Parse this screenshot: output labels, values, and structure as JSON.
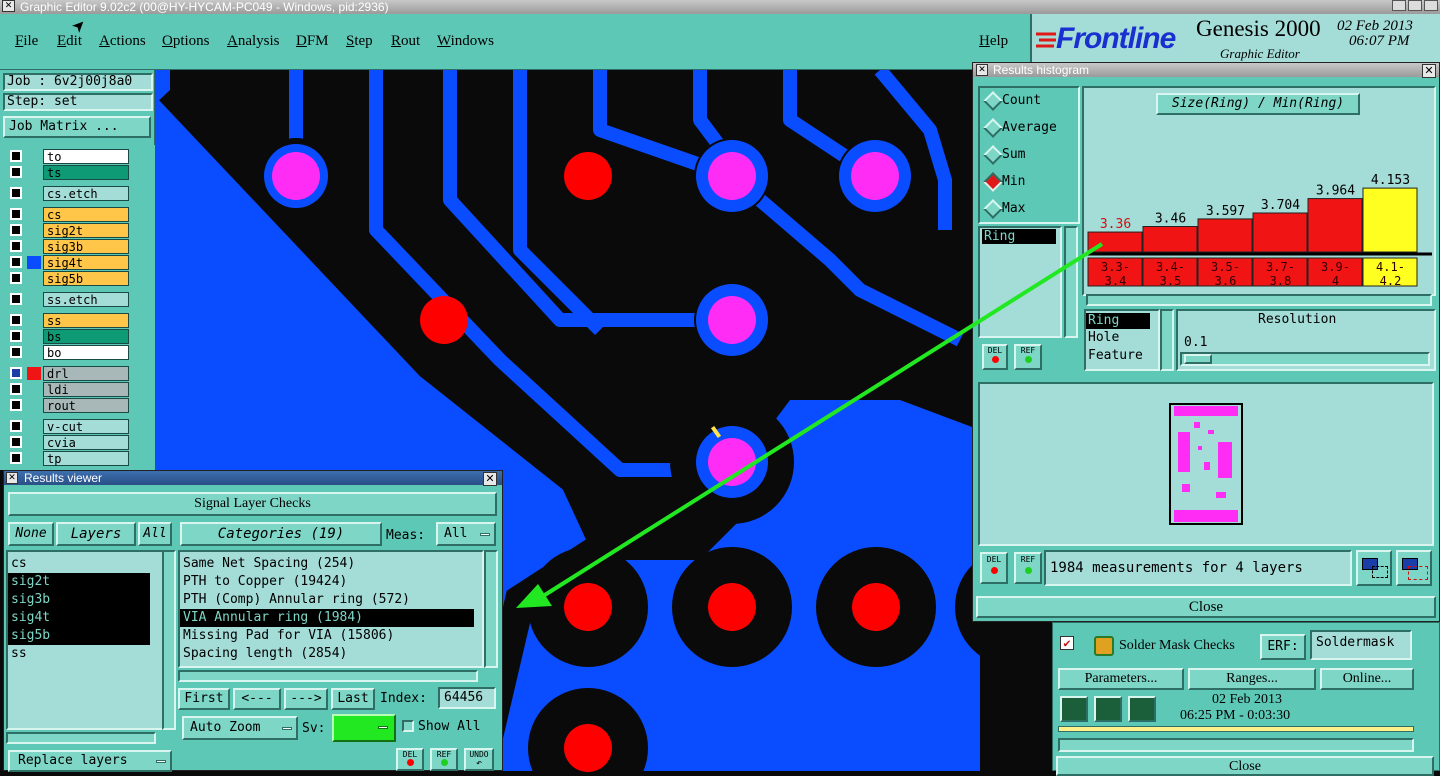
{
  "window": {
    "title": "Graphic Editor 9.02c2 (00@HY-HYCAM-PC049 - Windows, pid:2936)"
  },
  "menu": {
    "items": [
      "File",
      "Edit",
      "Actions",
      "Options",
      "Analysis",
      "DFM",
      "Step",
      "Rout",
      "Windows"
    ],
    "help": "Help"
  },
  "brand": {
    "logo": "Frontline",
    "product": "Genesis 2000",
    "subtitle": "Graphic Editor",
    "date": "02 Feb 2013",
    "time": "06:07 PM"
  },
  "left": {
    "job": "Job : 6v2j00j8a0",
    "step": "Step: set",
    "job_matrix": "Job Matrix ...",
    "layers": [
      {
        "name": "to",
        "color": "#ffffff"
      },
      {
        "name": "ts",
        "color": "#0d9a74"
      },
      {
        "name": "cs.etch",
        "color": "#a4dcd7"
      },
      {
        "name": "cs",
        "color": "#ffc64a"
      },
      {
        "name": "sig2t",
        "color": "#ffc64a"
      },
      {
        "name": "sig3b",
        "color": "#ffc64a"
      },
      {
        "name": "sig4t",
        "color": "#ffc64a"
      },
      {
        "name": "sig5b",
        "color": "#ffc64a"
      },
      {
        "name": "ss.etch",
        "color": "#a4dcd7"
      },
      {
        "name": "ss",
        "color": "#ffc64a"
      },
      {
        "name": "bs",
        "color": "#0d9a74"
      },
      {
        "name": "bo",
        "color": "#ffffff"
      },
      {
        "name": "drl",
        "color": "#a8b8b8"
      },
      {
        "name": "ldi",
        "color": "#a8b8b8"
      },
      {
        "name": "rout",
        "color": "#a8b8b8"
      },
      {
        "name": "v-cut",
        "color": "#a4dcd7"
      },
      {
        "name": "cvia",
        "color": "#a4dcd7"
      },
      {
        "name": "tp",
        "color": "#a4dcd7"
      }
    ]
  },
  "results_viewer": {
    "title": "Results viewer",
    "header": "Signal Layer Checks",
    "none": "None",
    "layers_label": "Layers",
    "all": "All",
    "categories_label": "Categories (19)",
    "meas_label": "Meas:",
    "meas_value": "All",
    "layer_list": [
      {
        "name": "cs",
        "sel": false
      },
      {
        "name": "sig2t",
        "sel": true
      },
      {
        "name": "sig3b",
        "sel": true
      },
      {
        "name": "sig4t",
        "sel": true
      },
      {
        "name": "sig5b",
        "sel": true
      },
      {
        "name": "ss",
        "sel": false
      }
    ],
    "categories": [
      {
        "name": "Same Net Spacing (254)",
        "sel": false
      },
      {
        "name": "PTH to Copper (19424)",
        "sel": false
      },
      {
        "name": "PTH (Comp) Annular ring (572)",
        "sel": false
      },
      {
        "name": "VIA Annular ring (1984)",
        "sel": true
      },
      {
        "name": "Missing Pad for VIA (15806)",
        "sel": false
      },
      {
        "name": "Spacing length (2854)",
        "sel": false
      }
    ],
    "nav": {
      "first": "First",
      "prev": "<---",
      "next": "--->",
      "last": "Last",
      "index_label": "Index:",
      "index_value": "64456"
    },
    "auto_zoom": "Auto Zoom",
    "sv_label": "Sv:",
    "show_all": "Show All",
    "replace_layers": "Replace layers",
    "del": "DEL",
    "ref": "REF",
    "undo": "UNDO"
  },
  "histogram": {
    "title": "Results histogram",
    "chart_title": "Size(Ring) / Min(Ring)",
    "modes": [
      {
        "name": "Count",
        "sel": false
      },
      {
        "name": "Average",
        "sel": false
      },
      {
        "name": "Sum",
        "sel": false
      },
      {
        "name": "Min",
        "sel": true
      },
      {
        "name": "Max",
        "sel": false
      }
    ],
    "attr_selected": "Ring",
    "group_list": [
      "Ring",
      "Hole",
      "Feature"
    ],
    "resolution_label": "Resolution",
    "resolution_value": "0.1",
    "summary": "1984 measurements for 4 layers",
    "close": "Close",
    "del": "DEL",
    "ref": "REF"
  },
  "chart_data": {
    "type": "bar",
    "title": "Size(Ring) / Min(Ring)",
    "categories": [
      "3.3-3.4",
      "3.4-3.5",
      "3.5-3.6",
      "3.7-3.8",
      "3.9-4",
      "4.1-4.2"
    ],
    "values": [
      3.36,
      3.46,
      3.597,
      3.704,
      3.964,
      4.153
    ],
    "value_labels": [
      "3.36",
      "3.46",
      "3.597",
      "3.704",
      "3.964",
      "4.153"
    ],
    "bar_colors": [
      "#f01414",
      "#f01414",
      "#f01414",
      "#f01414",
      "#f01414",
      "#ffff20"
    ]
  },
  "solder_mask": {
    "label": "Solder Mask Checks",
    "erf_label": "ERF:",
    "erf_value": "Soldermask",
    "parameters": "Parameters...",
    "ranges": "Ranges...",
    "online": "Online...",
    "date": "02 Feb 2013",
    "time": "06:25 PM - 0:03:30",
    "close": "Close"
  },
  "colors": {
    "copper": "#0a4cff",
    "board": "#0a0a0a",
    "panel": "#5ec8b7",
    "drill": "#ff0000",
    "via_pad": "#ff2cf5",
    "arrow": "#22e822"
  }
}
